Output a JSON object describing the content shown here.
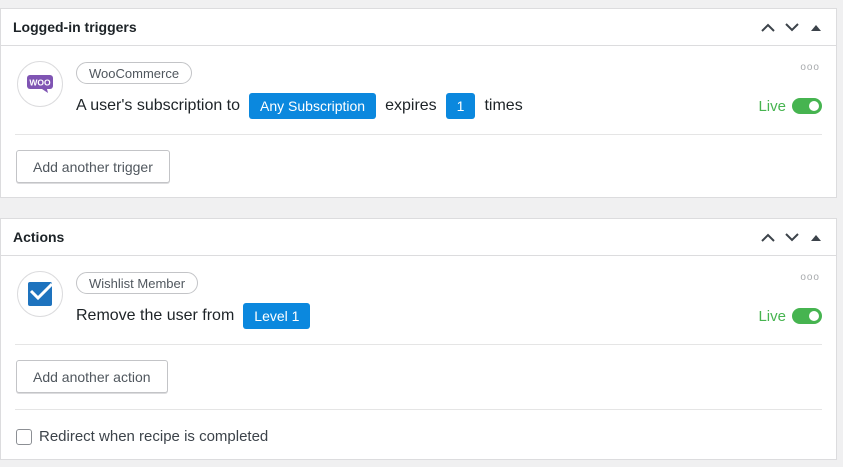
{
  "triggers": {
    "title": "Logged-in triggers",
    "items": [
      {
        "icon": "woocommerce-icon",
        "integration": "WooCommerce",
        "sentence_start": "A user's subscription to",
        "token1": "Any Subscription",
        "middle": "expires",
        "token2": "1",
        "end": "times",
        "status": "Live",
        "more": "ooo"
      }
    ],
    "add_label": "Add another trigger"
  },
  "actions": {
    "title": "Actions",
    "items": [
      {
        "icon": "wishlist-member-icon",
        "integration": "Wishlist Member",
        "sentence_start": "Remove the user from",
        "token1": "Level 1",
        "status": "Live",
        "more": "ooo"
      }
    ],
    "add_label": "Add another action",
    "redirect_label": "Redirect when recipe is completed"
  },
  "colors": {
    "token": "#0b88de",
    "live": "#46b450",
    "woo": "#7f54b3",
    "wishlist": "#1e73be"
  }
}
